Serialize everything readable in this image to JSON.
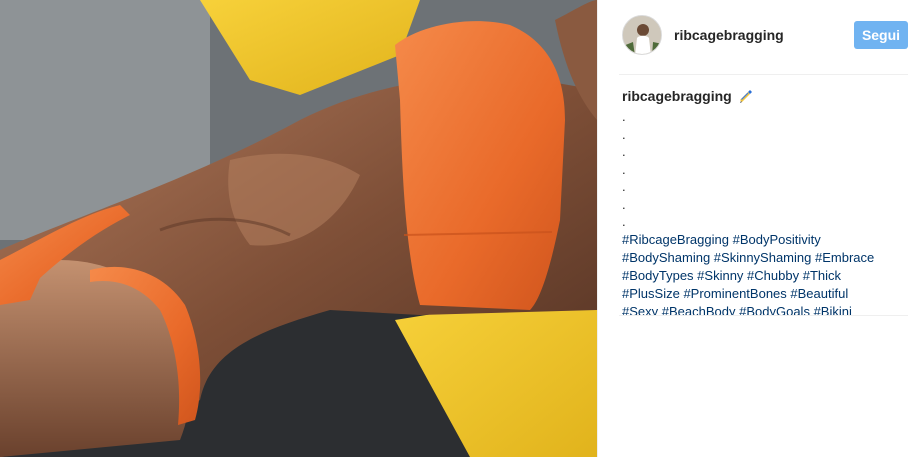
{
  "post": {
    "username": "ribcagebragging",
    "follow_label": "Segui",
    "caption": {
      "author": "ribcagebragging",
      "emoji_icon": "pencil-icon",
      "dots": [
        ".",
        ".",
        ".",
        ".",
        ".",
        ".",
        "."
      ],
      "hashtags": [
        "#RibcageBragging",
        "#BodyPositivity",
        "#BodyShaming",
        "#SkinnyShaming",
        "#Embrace",
        "#BodyTypes",
        "#Skinny",
        "#Chubby",
        "#Thick",
        "#PlusSize",
        "#ProminentBones",
        "#Beautiful",
        "#Sexy",
        "#BeachBody",
        "#BodyGoals",
        "#Bikini"
      ]
    }
  },
  "colors": {
    "accent_follow": "#70b3f1",
    "hashtag_link": "#003569",
    "text": "#262626",
    "divider": "#efefef"
  }
}
